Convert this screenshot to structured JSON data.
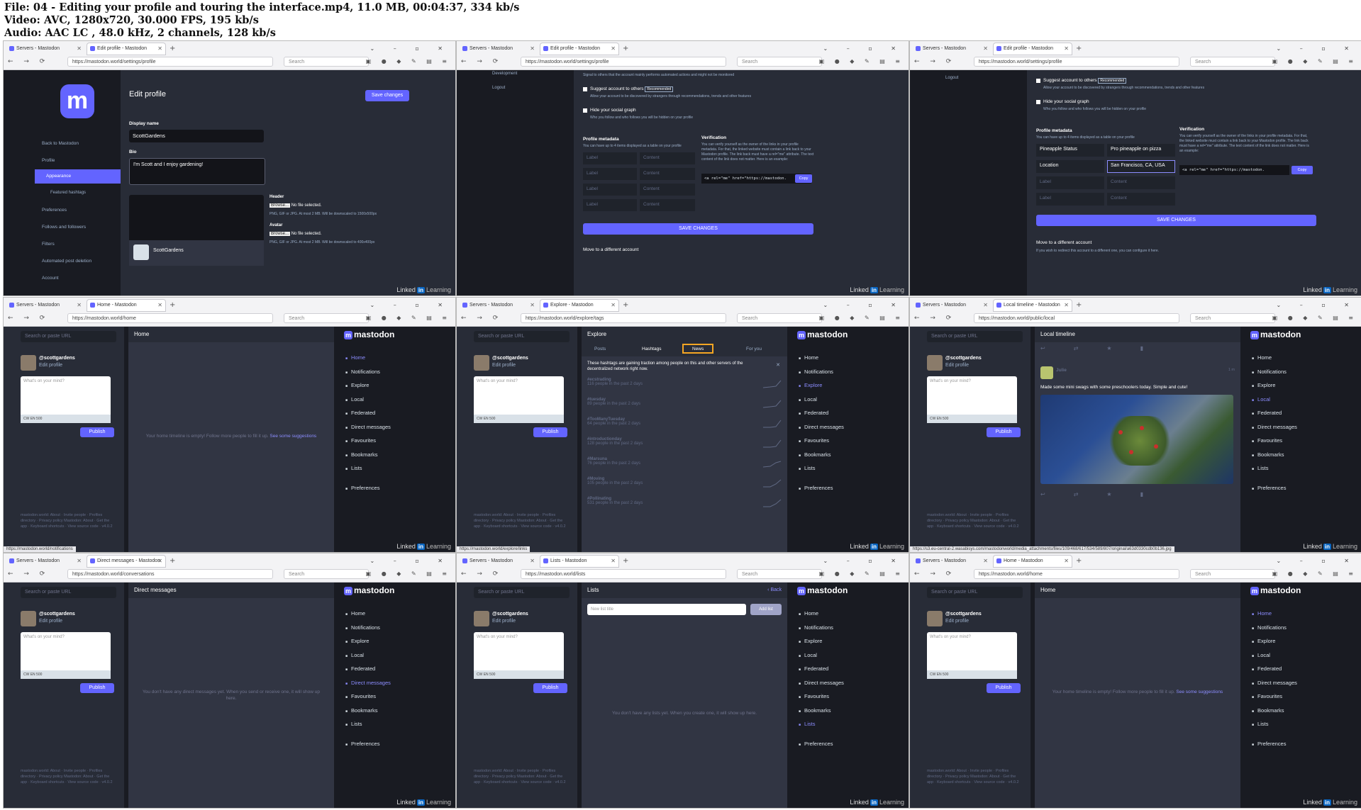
{
  "header": {
    "line1": "File: 04 - Editing your profile and touring the interface.mp4, 11.0 MB, 00:04:37, 334 kb/s",
    "line2": "Video: AVC, 1280x720, 30.000 FPS, 195 kb/s",
    "line3": "Audio: AAC LC , 48.0 kHz, 2 channels, 128 kb/s"
  },
  "common": {
    "tab1": "Servers - Mastodon",
    "search_placeholder": "Search",
    "linkedin": "Linked",
    "linkedin_in": "in",
    "linkedin_learning": "Learning",
    "search_url": "Search or paste URL",
    "handle": "@scottgardens",
    "edit_profile": "Edit profile",
    "compose_placeholder": "What's on your mind?",
    "compose_tools": "CW  EN  500",
    "publish": "Publish",
    "footer": "mastodon.world: About · Invite people · Profiles directory · Privacy policy  Mastodon: About · Get the app · Keyboard shortcuts · View source code · v4.0.2",
    "logo": "mastodon",
    "menu": [
      "Home",
      "Notifications",
      "Explore",
      "Local",
      "Federated",
      "Direct messages",
      "Favourites",
      "Bookmarks",
      "Lists",
      "Preferences"
    ]
  },
  "frames": {
    "f1": {
      "tab": "Edit profile - Mastodon",
      "url": "https://mastodon.world/settings/profile",
      "title": "Edit profile",
      "save": "Save changes",
      "display_name_label": "Display name",
      "display_name": "ScottGardens",
      "bio_label": "Bio",
      "bio": "I'm Scott and I enjoy gardening!",
      "header_label": "Header",
      "avatar_label": "Avatar",
      "browse": "Browse...",
      "no_file": "No file selected.",
      "header_hint": "PNG, GIF or JPG. At most 2 MB. Will be downscaled to 1500x500px",
      "avatar_hint": "PNG, GIF or JPG. At most 2 MB. Will be downscaled to 400x400px",
      "preview_name": "ScottGardens",
      "side": [
        "Back to Mastodon",
        "Profile",
        "Appearance",
        "Featured hashtags",
        "Preferences",
        "Follows and followers",
        "Filters",
        "Automated post deletion",
        "Account"
      ]
    },
    "f2": {
      "tab": "Edit profile - Mastodon",
      "url": "https://mastodon.world/settings/profile",
      "top_hint": "Signal to others that the account mainly performs automated actions and might not be monitored",
      "side": [
        "Development",
        "Logout"
      ],
      "suggest": "Suggest account to others",
      "recommended": "Recommended",
      "suggest_hint": "Allow your account to be discovered by strangers through recommendations, trends and other features",
      "hide_graph": "Hide your social graph",
      "hide_hint": "Who you follow and who follows you will be hidden on your profile",
      "metadata": "Profile metadata",
      "metadata_hint": "You can have up to 4 items displayed as a table on your profile",
      "label_ph": "Label",
      "content_ph": "Content",
      "verification": "Verification",
      "verification_text": "You can verify yourself as the owner of the links in your profile metadata. For that, the linked website must contain a link back to your Mastodon profile. The link back must have a rel=\"me\" attribute. The text content of the link does not matter. Here is an example:",
      "code": "<a rel=\"me\" href=\"https://mastodon.",
      "copy": "Copy",
      "save": "SAVE CHANGES",
      "move": "Move to a different account"
    },
    "f3": {
      "tab": "Edit profile - Mastodon",
      "url": "https://mastodon.world/settings/profile",
      "side": [
        "Logout"
      ],
      "rows": [
        [
          "Pineapple Status",
          "Pro pineapple on pizza"
        ],
        [
          "Location",
          "San Francisco, CA, USA"
        ]
      ],
      "move": "Move to a different account",
      "move_hint": "If you wish to redirect this account to a different one, you can configure it here."
    },
    "f4": {
      "tab": "Home - Mastodon",
      "url": "https://mastodon.world/home",
      "col": "Home",
      "empty": "Your home timeline is empty! Follow more people to fill it up.",
      "empty_link": "See some suggestions",
      "status": "https://mastodon.world/notifications"
    },
    "f5": {
      "tab": "Explore - Mastodon",
      "url": "https://mastodon.world/explore/tags",
      "col": "Explore",
      "tabs": [
        "Posts",
        "Hashtags",
        "News",
        "For you"
      ],
      "intro": "These hashtags are gaining traction among people on this and other servers of the decentralized network right now.",
      "tags": [
        [
          "#ecstrading",
          "116 people in the past 2 days"
        ],
        [
          "#tuesday",
          "89 people in the past 2 days"
        ],
        [
          "#TooManyTuesday",
          "64 people in the past 2 days"
        ],
        [
          "#introductionday",
          "128 people in the past 2 days"
        ],
        [
          "#Marsuna",
          "76 people in the past 2 days"
        ],
        [
          "#Moving",
          "105 people in the past 2 days"
        ],
        [
          "#Pollinating",
          "531 people in the past 2 days"
        ]
      ],
      "status": "https://mastodon.world/explore/links"
    },
    "f6": {
      "tab": "Local timeline - Mastodon",
      "url": "https://mastodon.world/public/local",
      "col": "Local timeline",
      "author": "Julie",
      "time": "1 m",
      "post": "Made some mini swags with some preschoolers today. Simple and cute!",
      "status": "https://s3.eu-central-2.wasabisys.com/mastodonworld/media_attachments/files/109/468/617/534/589/807/original/a63d0330cdb0b136.jpg"
    },
    "f7": {
      "tab": "Direct messages - Mastodon",
      "url": "https://mastodon.world/conversations",
      "col": "Direct messages",
      "empty": "You don't have any direct messages yet. When you send or receive one, it will show up here."
    },
    "f8": {
      "tab": "Lists - Mastodon",
      "url": "https://mastodon.world/lists",
      "col": "Lists",
      "back": "Back",
      "new_list": "New list title",
      "add_list": "Add list",
      "empty": "You don't have any lists yet. When you create one, it will show up here."
    },
    "f9": {
      "tab": "Home - Mastodon",
      "url": "https://mastodon.world/home",
      "col": "Home",
      "empty": "Your home timeline is empty! Follow more people to fill it up.",
      "empty_link": "See some suggestions"
    }
  },
  "colors": {
    "accent": "#6364ff",
    "bg": "#191b22",
    "panel": "#282c37",
    "highlight": "#f5a623"
  }
}
